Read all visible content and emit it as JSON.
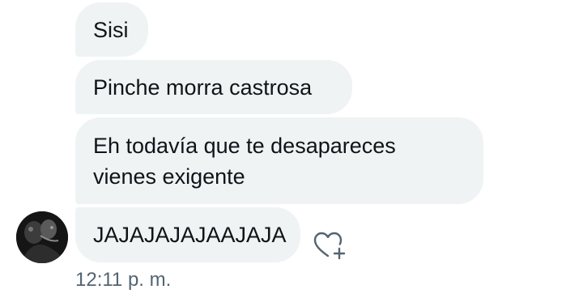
{
  "conversation": {
    "messages": [
      {
        "text": "Sisi"
      },
      {
        "text": "Pinche morra castrosa"
      },
      {
        "text": "Eh todavía que te desapareces vienes exigente"
      },
      {
        "text": "JAJAJAJAJAAJAJA"
      }
    ],
    "timestamp": "12:11 p. m."
  },
  "icons": {
    "avatar": "avatar",
    "react": "heart-plus-icon"
  },
  "colors": {
    "bubble_bg": "#eff3f4",
    "text": "#0f1419",
    "muted": "#536471"
  }
}
